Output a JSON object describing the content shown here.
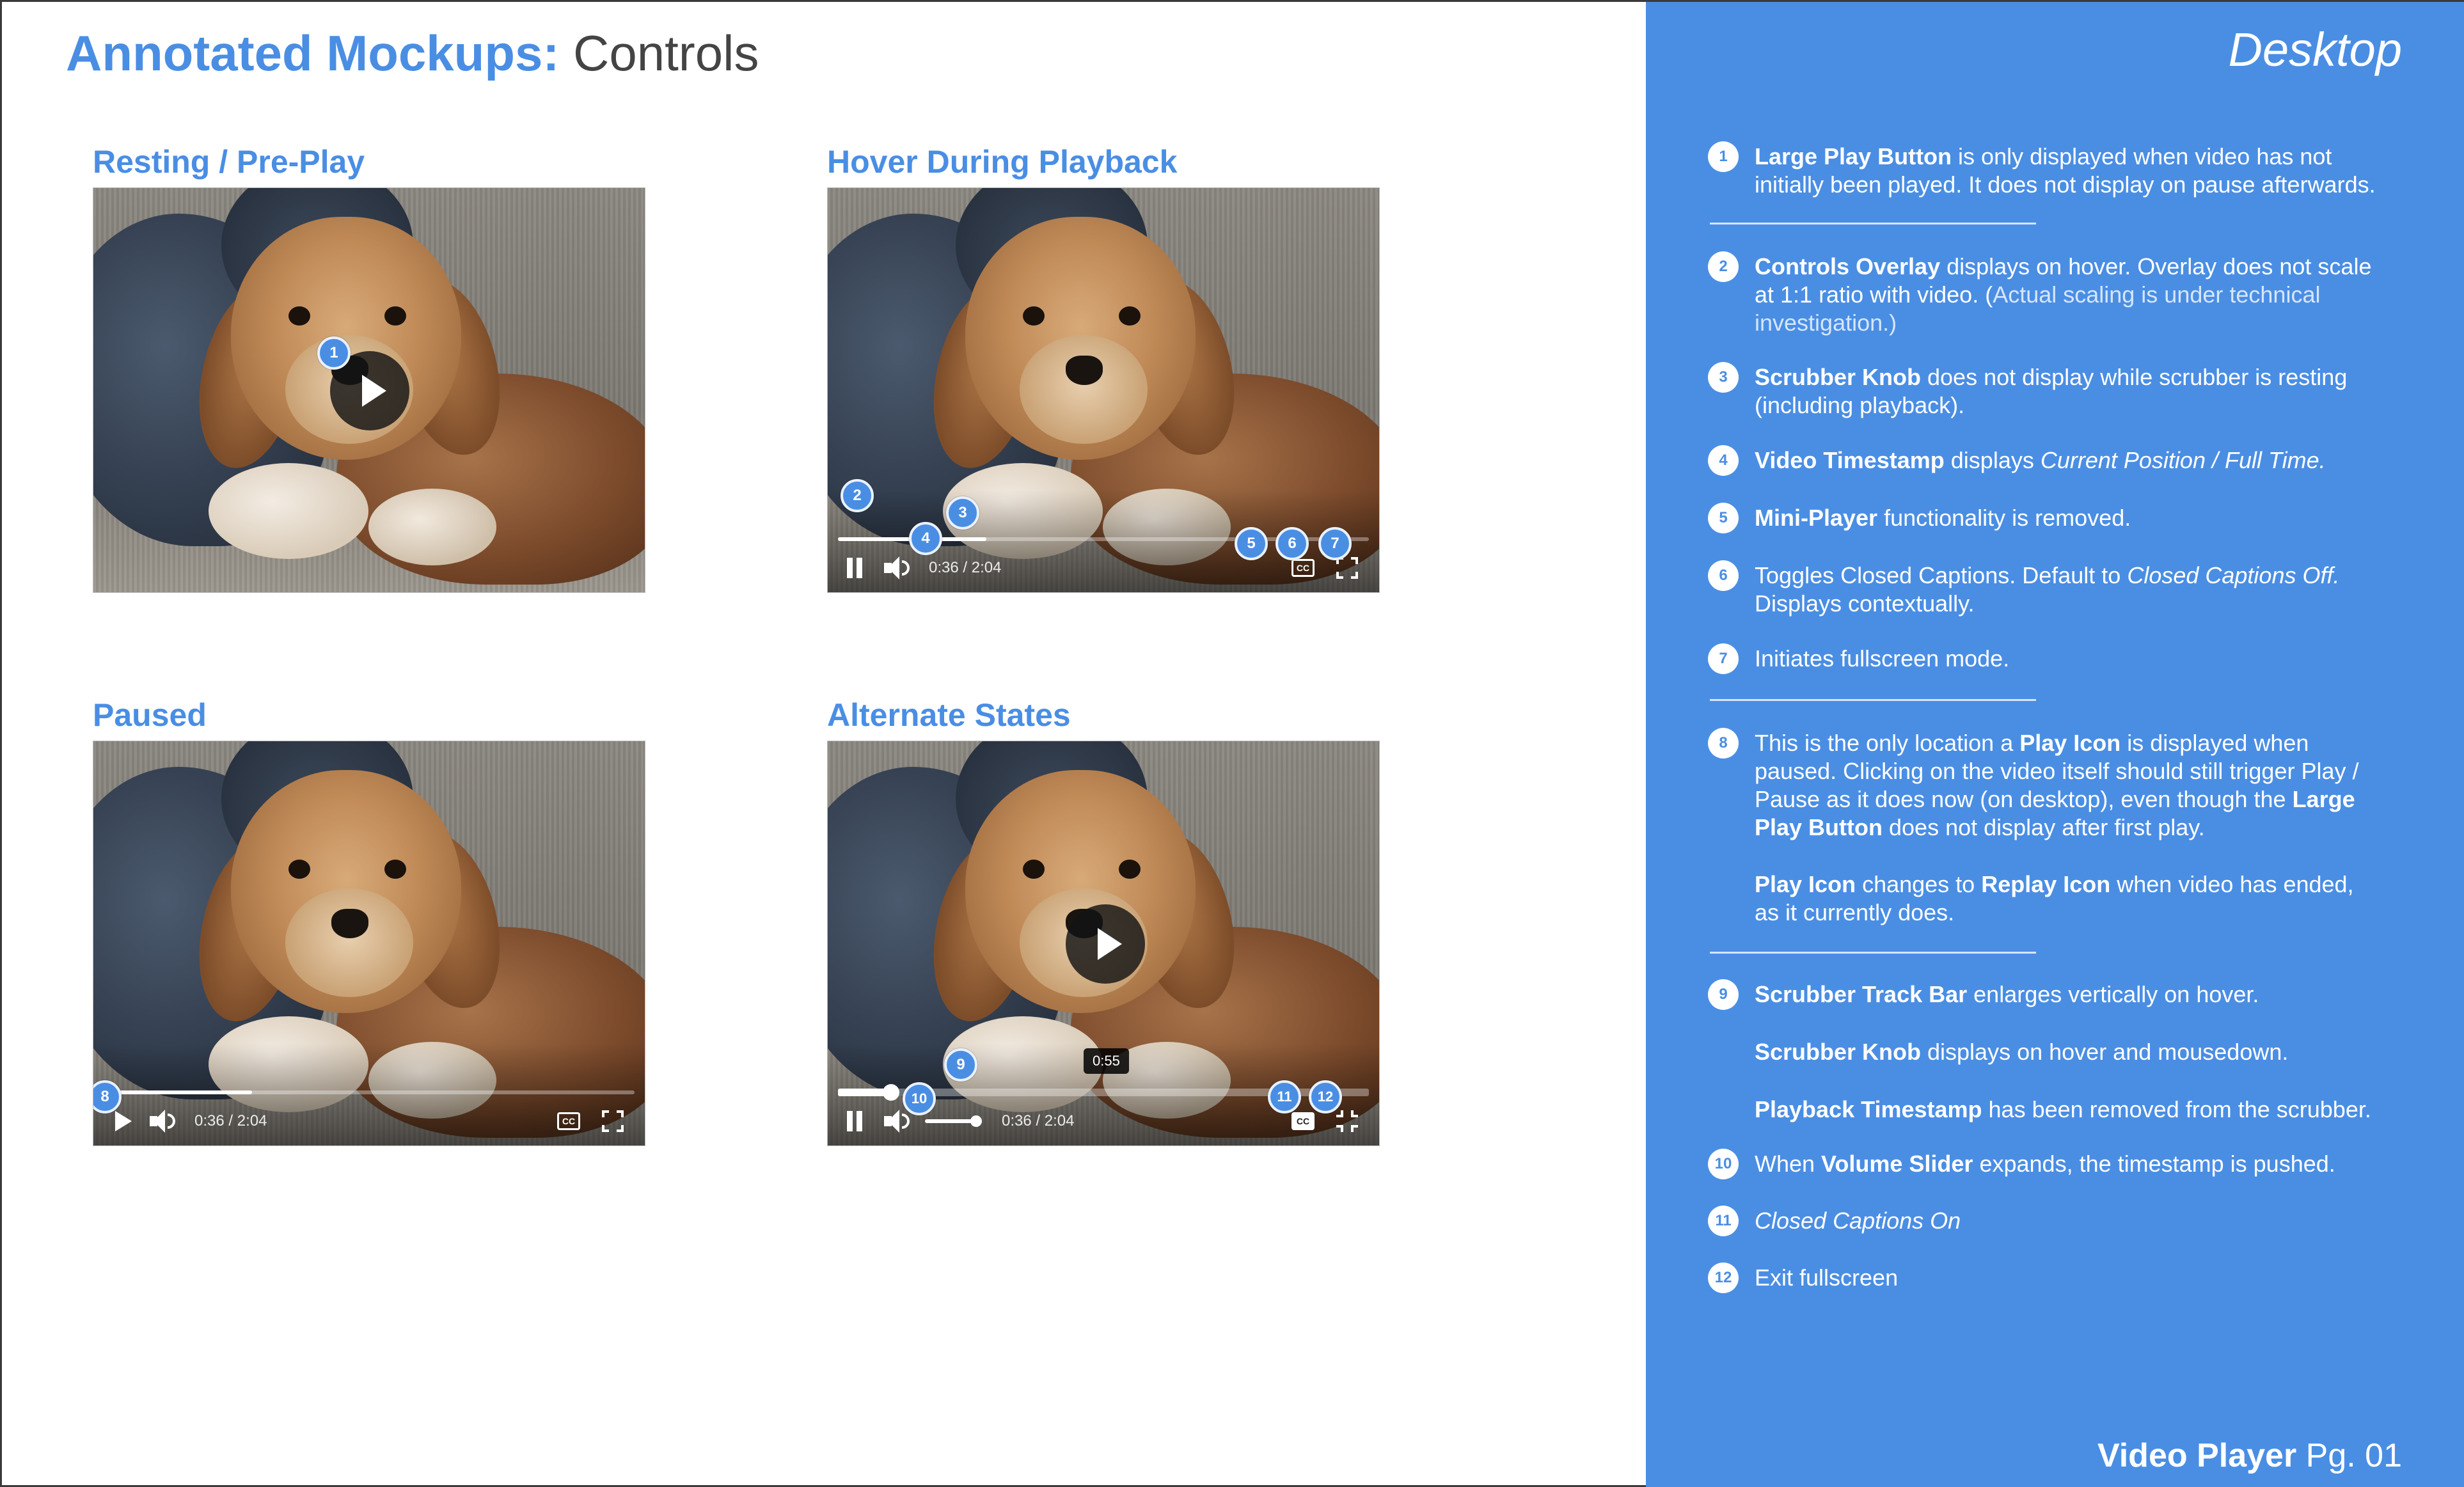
{
  "title": {
    "bold": "Annotated Mockups:",
    "light": "Controls"
  },
  "mockups": {
    "resting": {
      "label": "Resting / Pre-Play"
    },
    "hover": {
      "label": "Hover During Playback",
      "timestamp": "0:36 / 2:04",
      "cc": "CC"
    },
    "paused": {
      "label": "Paused",
      "timestamp": "0:36 / 2:04",
      "cc": "CC"
    },
    "alternate": {
      "label": "Alternate States",
      "timestamp": "0:36 / 2:04",
      "tooltip": "0:55",
      "cc": "CC"
    }
  },
  "markers": [
    "1",
    "2",
    "3",
    "4",
    "5",
    "6",
    "7",
    "8",
    "9",
    "10",
    "11",
    "12"
  ],
  "sidebar": {
    "title": "Desktop",
    "notes": [
      {
        "num": "1",
        "parts": [
          {
            "b": "Large Play Button"
          },
          {
            "t": " is only displayed when video has not initially been played. It does not display on pause afterwards."
          }
        ]
      },
      {
        "num": "2",
        "parts": [
          {
            "b": "Controls Overlay"
          },
          {
            "t": " displays on hover. Overlay does not scale at 1:1 ratio with video. ("
          },
          {
            "f": "Actual scaling is under technical investigation.)"
          }
        ]
      },
      {
        "num": "3",
        "parts": [
          {
            "b": "Scrubber Knob"
          },
          {
            "t": " does not display while scrubber is resting (including playback)."
          }
        ]
      },
      {
        "num": "4",
        "parts": [
          {
            "b": "Video Timestamp"
          },
          {
            "t": " displays "
          },
          {
            "i": "Current Position / Full Time."
          }
        ]
      },
      {
        "num": "5",
        "parts": [
          {
            "b": "Mini-Player"
          },
          {
            "t": " functionality is removed."
          }
        ]
      },
      {
        "num": "6",
        "parts": [
          {
            "t": "Toggles Closed Captions. Default to "
          },
          {
            "i": "Closed Captions Off."
          },
          {
            "t": " Displays contextually."
          }
        ]
      },
      {
        "num": "7",
        "parts": [
          {
            "t": "Initiates fullscreen mode."
          }
        ]
      },
      {
        "num": "8",
        "parts": [
          {
            "t": "This is the only location a "
          },
          {
            "b": "Play Icon"
          },
          {
            "t": " is displayed when paused. Clicking on the video itself should still trigger Play / Pause as it does now (on desktop), even though the "
          },
          {
            "b": "Large Play Button"
          },
          {
            "t": " does not display after first play."
          }
        ]
      },
      {
        "num": "",
        "parts": [
          {
            "b": "Play Icon"
          },
          {
            "t": " changes to "
          },
          {
            "b": "Replay Icon"
          },
          {
            "t": " when video has ended, as it currently does."
          }
        ]
      },
      {
        "num": "9",
        "parts": [
          {
            "b": "Scrubber Track Bar"
          },
          {
            "t": " enlarges vertically on hover."
          }
        ]
      },
      {
        "num": "",
        "parts": [
          {
            "b": "Scrubber Knob"
          },
          {
            "t": " displays on hover and mousedown."
          }
        ]
      },
      {
        "num": "",
        "parts": [
          {
            "b": "Playback Timestamp"
          },
          {
            "t": " has been removed from the scrubber."
          }
        ]
      },
      {
        "num": "10",
        "parts": [
          {
            "t": "When "
          },
          {
            "b": "Volume Slider"
          },
          {
            "t": " expands, the timestamp is pushed."
          }
        ]
      },
      {
        "num": "11",
        "parts": [
          {
            "i": "Closed Captions On"
          }
        ]
      },
      {
        "num": "12",
        "parts": [
          {
            "t": "Exit fullscreen"
          }
        ]
      }
    ],
    "footer": {
      "bold": "Video Player",
      "light": " Pg. 01"
    }
  }
}
